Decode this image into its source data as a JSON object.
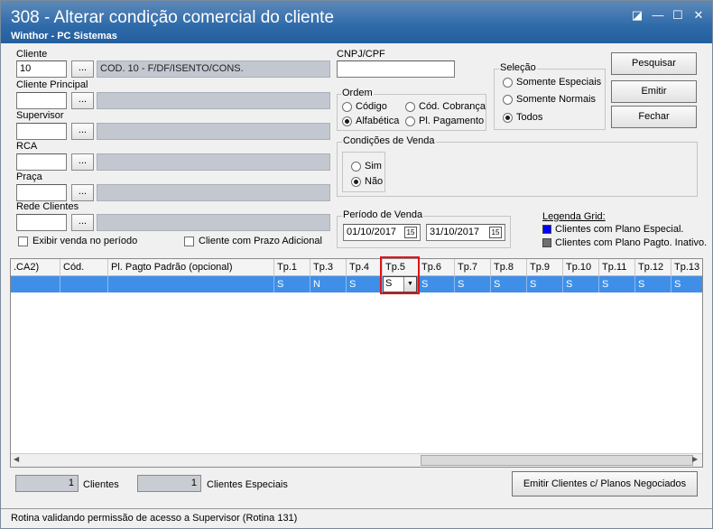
{
  "window": {
    "title": "308 - Alterar condição comercial do cliente",
    "subtitle": "Winthor - PC Sistemas"
  },
  "filters": {
    "cliente_label": "Cliente",
    "cliente_code": "10",
    "cliente_desc": "COD. 10 - F/DF/ISENTO/CONS.",
    "cliente_principal_label": "Cliente Principal",
    "supervisor_label": "Supervisor",
    "rca_label": "RCA",
    "praca_label": "Praça",
    "rede_label": "Rede Clientes",
    "browse_label": "...",
    "exibir_venda_label": "Exibir venda no período",
    "prazo_adicional_label": "Cliente com Prazo Adicional"
  },
  "cnpj": {
    "label": "CNPJ/CPF",
    "value": ""
  },
  "ordem": {
    "title": "Ordem",
    "codigo": "Código",
    "alfabetica": "Alfabética",
    "cod_cobranca": "Cód. Cobrança",
    "pl_pagamento": "Pl. Pagamento"
  },
  "selecao": {
    "title": "Seleção",
    "especiais": "Somente Especiais",
    "normais": "Somente Normais",
    "todos": "Todos"
  },
  "condicoes": {
    "title": "Condições de Venda",
    "sim": "Sim",
    "nao": "Não"
  },
  "periodo": {
    "title": "Período de Venda",
    "start": "01/10/2017",
    "end": "31/10/2017",
    "cal": "15"
  },
  "legenda": {
    "title": "Legenda Grid:",
    "especial": "Clientes com Plano Especial.",
    "inativo": "Clientes com Plano Pagto. Inativo.",
    "especial_color": "#0000ff",
    "inativo_color": "#707070"
  },
  "buttons": {
    "pesquisar": "Pesquisar",
    "emitir": "Emitir",
    "fechar": "Fechar",
    "emitir_planos": "Emitir Clientes c/ Planos Negociados"
  },
  "grid": {
    "headers": {
      "ca2": ".CA2)",
      "cod": "Cód.",
      "plano": "Pl. Pagto Padrão (opcional)",
      "tp1": "Tp.1",
      "tp3": "Tp.3",
      "tp4": "Tp.4",
      "tp5": "Tp.5",
      "tp6": "Tp.6",
      "tp7": "Tp.7",
      "tp8": "Tp.8",
      "tp9": "Tp.9",
      "tp10": "Tp.10",
      "tp11": "Tp.11",
      "tp12": "Tp.12",
      "tp13": "Tp.13"
    },
    "row": {
      "ca2": "",
      "cod": "",
      "plano": "",
      "tp1": "S",
      "tp3": "N",
      "tp4": "S",
      "tp5": "S",
      "tp6": "S",
      "tp7": "S",
      "tp8": "S",
      "tp9": "S",
      "tp10": "S",
      "tp11": "S",
      "tp12": "S",
      "tp13": "S"
    }
  },
  "counters": {
    "clientes_count": "1",
    "clientes_label": "Clientes",
    "especiais_count": "1",
    "especiais_label": "Clientes Especiais"
  },
  "status": {
    "text": "Rotina validando permissão de acesso a Supervisor (Rotina 131)"
  }
}
